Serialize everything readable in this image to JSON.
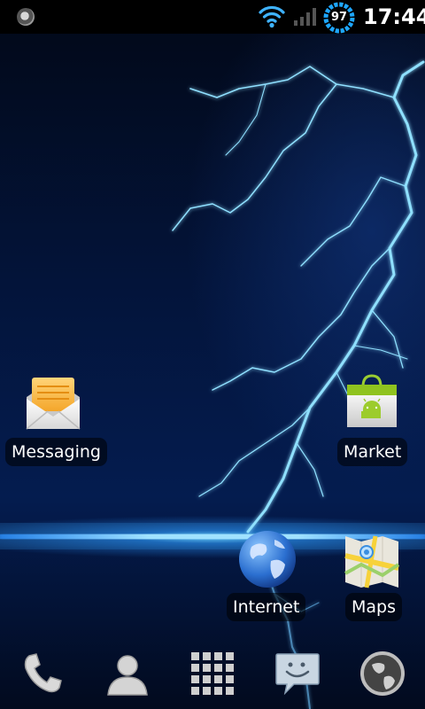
{
  "status_bar": {
    "time": "17:44",
    "battery_level": "97",
    "icons": [
      "notification-icon",
      "wifi-icon",
      "cell-signal-icon",
      "battery-icon"
    ]
  },
  "apps": [
    {
      "id": "messaging",
      "label": "Messaging",
      "icon": "messaging-icon"
    },
    {
      "id": "market",
      "label": "Market",
      "icon": "market-icon"
    },
    {
      "id": "internet",
      "label": "Internet",
      "icon": "internet-globe-icon"
    },
    {
      "id": "maps",
      "label": "Maps",
      "icon": "maps-icon"
    }
  ],
  "dock": {
    "items": [
      "phone-icon",
      "contacts-icon",
      "app-drawer-icon",
      "chat-icon",
      "browser-icon"
    ]
  },
  "colors": {
    "status_bar_bg": "#000000",
    "wallpaper_dark": "#03143a",
    "lightning": "#7fd8ff",
    "horizon_glow": "#9fe6ff",
    "battery_ring": "#1ea7ff"
  }
}
